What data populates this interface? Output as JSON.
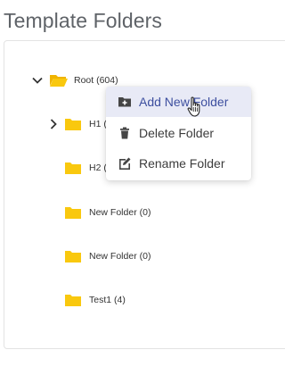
{
  "page": {
    "title": "Template Folders"
  },
  "tree": {
    "root": {
      "label": "Root (604)",
      "icon": "folder-open-icon",
      "expanded": true
    },
    "children": [
      {
        "label": "H1 (",
        "icon": "folder-icon",
        "has_children": true
      },
      {
        "label": "H2 (",
        "icon": "folder-icon",
        "has_children": false
      },
      {
        "label": "New Folder (0)",
        "icon": "folder-icon",
        "has_children": false
      },
      {
        "label": "New Folder (0)",
        "icon": "folder-icon",
        "has_children": false
      },
      {
        "label": "Test1 (4)",
        "icon": "folder-icon",
        "has_children": false
      }
    ]
  },
  "context_menu": {
    "items": [
      {
        "label": "Add New Folder",
        "icon": "folder-plus-icon",
        "hovered": true
      },
      {
        "label": "Delete Folder",
        "icon": "trash-icon",
        "hovered": false
      },
      {
        "label": "Rename Folder",
        "icon": "edit-icon",
        "hovered": false
      }
    ]
  },
  "colors": {
    "folder": "#f9c80e",
    "menu_hover_bg": "#e8eaf6",
    "menu_hover_text": "#3d4f9f",
    "title": "#5f6368"
  }
}
